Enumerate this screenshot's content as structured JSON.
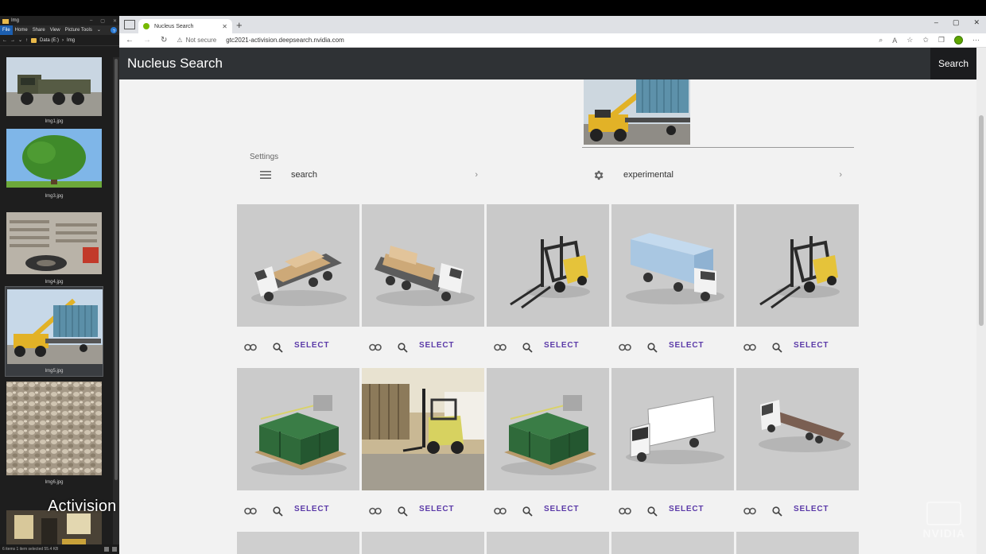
{
  "explorer": {
    "title": "Img",
    "ribbon_tabs": [
      "File",
      "Home",
      "Share",
      "View",
      "Picture Tools"
    ],
    "path_drive": "Data (E:)",
    "path_folder": "Img",
    "items": [
      {
        "caption": "Img1.jpg",
        "icon": "military-truck"
      },
      {
        "caption": "Img3.jpg",
        "icon": "tree"
      },
      {
        "caption": "Img4.jpg",
        "icon": "pallets-tire"
      },
      {
        "caption": "Img5.jpg",
        "icon": "container-crane",
        "selected": true
      },
      {
        "caption": "Img6.jpg",
        "icon": "gravel"
      },
      {
        "caption": "",
        "icon": "warehouse"
      }
    ],
    "status_left": "6 items  1 item selected  55.4 KB"
  },
  "overlay_text": "Activision",
  "browser": {
    "tab_title": "Nucleus Search",
    "security_label": "Not secure",
    "url": "gtc2021-activision.deepsearch.nvidia.com"
  },
  "app": {
    "title": "Nucleus Search",
    "search_button": "Search",
    "settings_label": "Settings",
    "search_row_label": "search",
    "experimental_row_label": "experimental",
    "select_label": "SELECT"
  },
  "results": [
    {
      "icon": "flatbed-truck-with-boxes"
    },
    {
      "icon": "flatbed-truck-with-boxes-rear"
    },
    {
      "icon": "forklift"
    },
    {
      "icon": "container-truck"
    },
    {
      "icon": "forklift"
    },
    {
      "icon": "military-crates-pallet"
    },
    {
      "icon": "forklift-yard-photo"
    },
    {
      "icon": "military-crates-pallet"
    },
    {
      "icon": "box-truck"
    },
    {
      "icon": "flatbed-truck"
    }
  ],
  "watermark": "NVIDIA",
  "colors": {
    "appbar": "#2f3235",
    "select_text": "#5b3aa8",
    "nvidia_green": "#76b900"
  }
}
